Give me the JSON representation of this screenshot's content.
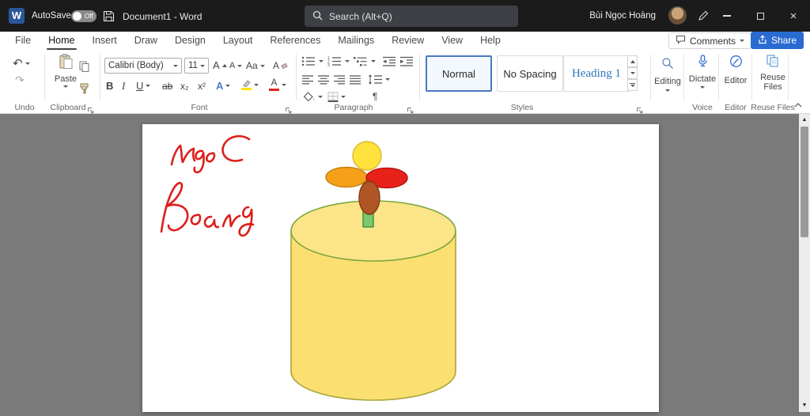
{
  "titlebar": {
    "app_icon_letter": "W",
    "autosave_label": "AutoSave",
    "autosave_state": "Off",
    "window_title": "Document1 - Word",
    "search_placeholder": "Search (Alt+Q)",
    "user_name": "Bùi Ngọc Hoàng"
  },
  "tabs": {
    "items": [
      "File",
      "Home",
      "Insert",
      "Draw",
      "Design",
      "Layout",
      "References",
      "Mailings",
      "Review",
      "View",
      "Help"
    ],
    "active": "Home"
  },
  "top_actions": {
    "comments_label": "Comments",
    "share_label": "Share",
    "share_color": "#2a6bd2"
  },
  "ribbon": {
    "undo": {
      "label": "Undo"
    },
    "clipboard": {
      "label": "Clipboard",
      "paste_label": "Paste"
    },
    "font": {
      "label": "Font",
      "family": "Calibri (Body)",
      "size": "11",
      "bold": "B",
      "italic": "I",
      "underline": "U",
      "strikethrough": "ab",
      "subscript": "x₂",
      "superscript": "x²",
      "text_effects": "A",
      "grow_font": "A",
      "shrink_font": "A",
      "change_case": "Aa",
      "clear_formatting": "A",
      "font_color_letter": "A",
      "font_color_bar": "#e0241b",
      "highlight_bar": "#ffe400"
    },
    "paragraph": {
      "label": "Paragraph",
      "pilcrow": "¶"
    },
    "styles": {
      "label": "Styles",
      "items": [
        {
          "name": "Normal",
          "selected": true
        },
        {
          "name": "No Spacing",
          "selected": false
        },
        {
          "name": "Heading 1",
          "selected": false
        }
      ],
      "heading_color": "#2e74b5"
    },
    "editing": {
      "label": "Editing"
    },
    "voice": {
      "label": "Voice",
      "dictate_label": "Dictate"
    },
    "editor": {
      "label": "Editor",
      "button_label": "Editor"
    },
    "reuse_files": {
      "label": "Reuse Files",
      "line1": "Reuse",
      "line2": "Files"
    }
  },
  "drawing": {
    "ink": {
      "text_line1": "ngoc",
      "text_line2": "hoang",
      "color": "#dc1f1a"
    },
    "flower": {
      "top_petal": "#ffe23c",
      "left_petal": "#f6a019",
      "right_petal": "#e8211a",
      "center": "#b05526",
      "stem": "#7cc96b"
    },
    "cylinder": {
      "body_fill": "#fbdf70",
      "top_fill": "#fce489",
      "outline": "#8fa63e"
    }
  }
}
